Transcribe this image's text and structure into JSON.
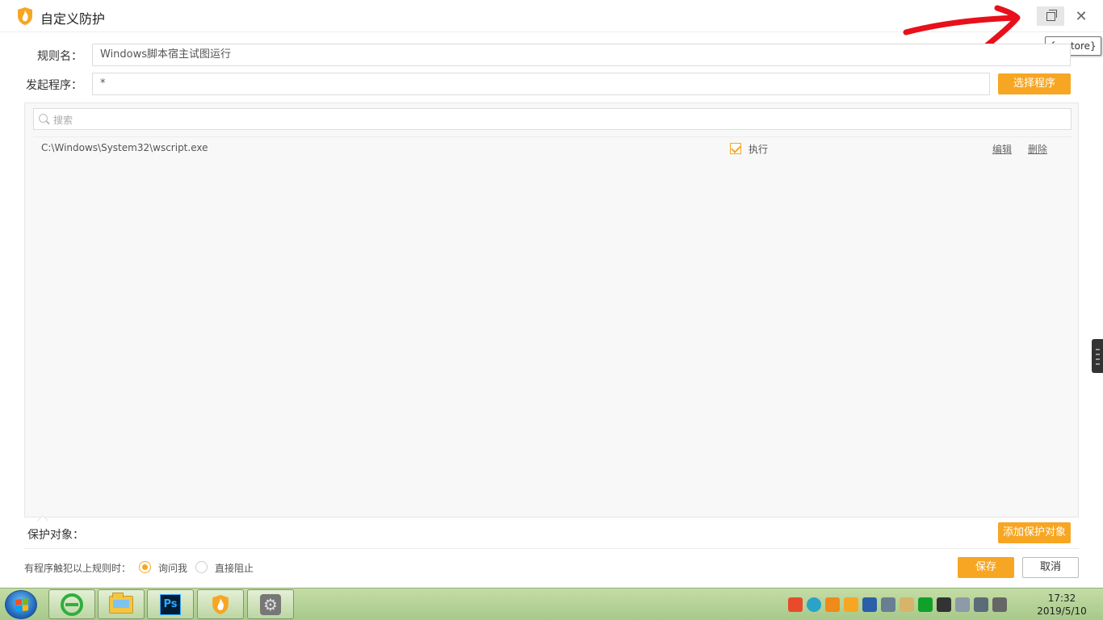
{
  "window": {
    "title": "自定义防护",
    "tooltip": "{restore}"
  },
  "form": {
    "rule_name_label": "规则名：",
    "rule_name_value": "Windows脚本宿主试图运行",
    "initiator_label": "发起程序：",
    "initiator_value": "*",
    "select_program_button": "选择程序"
  },
  "program_list": {
    "search_placeholder": "搜索",
    "rows": [
      {
        "path": "C:\\Windows\\System32\\wscript.exe",
        "action": "执行",
        "checked": true,
        "edit": "编辑",
        "delete": "删除"
      }
    ]
  },
  "protect": {
    "label": "保护对象：",
    "add_button": "添加保护对象"
  },
  "footer": {
    "trigger_label": "有程序触犯以上规则时：",
    "option_ask": "询问我",
    "option_block": "直接阻止",
    "selected": "ask",
    "save_button": "保存",
    "cancel_button": "取消"
  },
  "taskbar": {
    "time": "17:32",
    "date": "2019/5/10",
    "ps_label": "Ps"
  },
  "colors": {
    "accent": "#f7a623",
    "annotation": "#e8101a"
  }
}
